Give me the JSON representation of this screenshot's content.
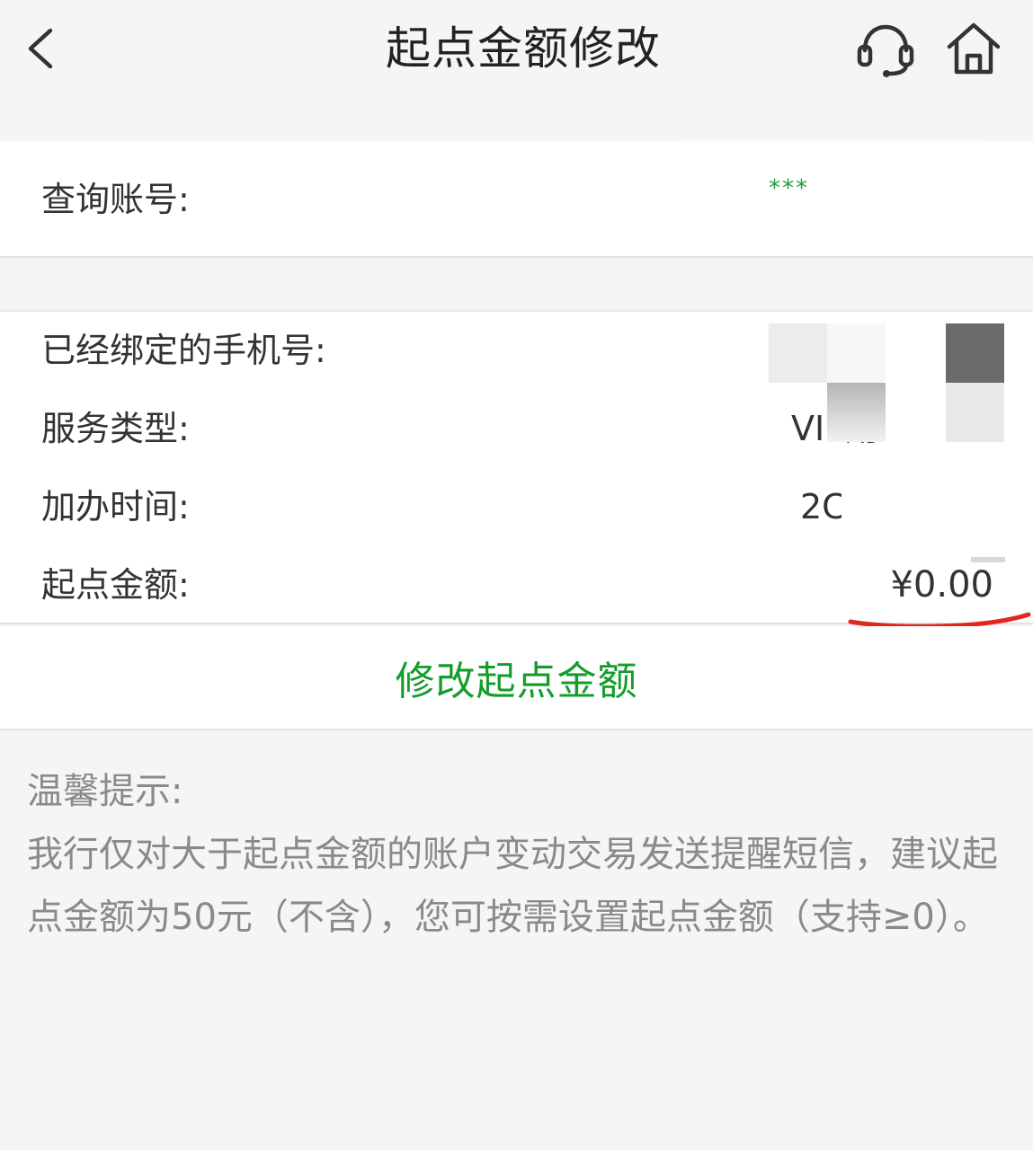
{
  "header": {
    "title": "起点金额修改",
    "back_icon": "chevron-left-icon",
    "service_icon": "headset-icon",
    "home_icon": "home-icon"
  },
  "account": {
    "label": "查询账号:",
    "value_masked": "***"
  },
  "info": {
    "phone_label": "已经绑定的手机号:",
    "service_type_label": "服务类型:",
    "service_type_value": "VIP用",
    "join_time_label": "加办时间:",
    "join_time_value": "2C",
    "threshold_label": "起点金额:",
    "threshold_value": "¥0.00"
  },
  "action": {
    "modify_label": "修改起点金额"
  },
  "tips": {
    "title": "温馨提示:",
    "body": "我行仅对大于起点金额的账户变动交易发送提醒短信，建议起点金额为50元（不含），您可按需设置起点金额（支持≥0）。"
  },
  "colors": {
    "accent_green": "#149d2b",
    "annotation_red": "#e0281e",
    "background": "#f5f5f5"
  }
}
